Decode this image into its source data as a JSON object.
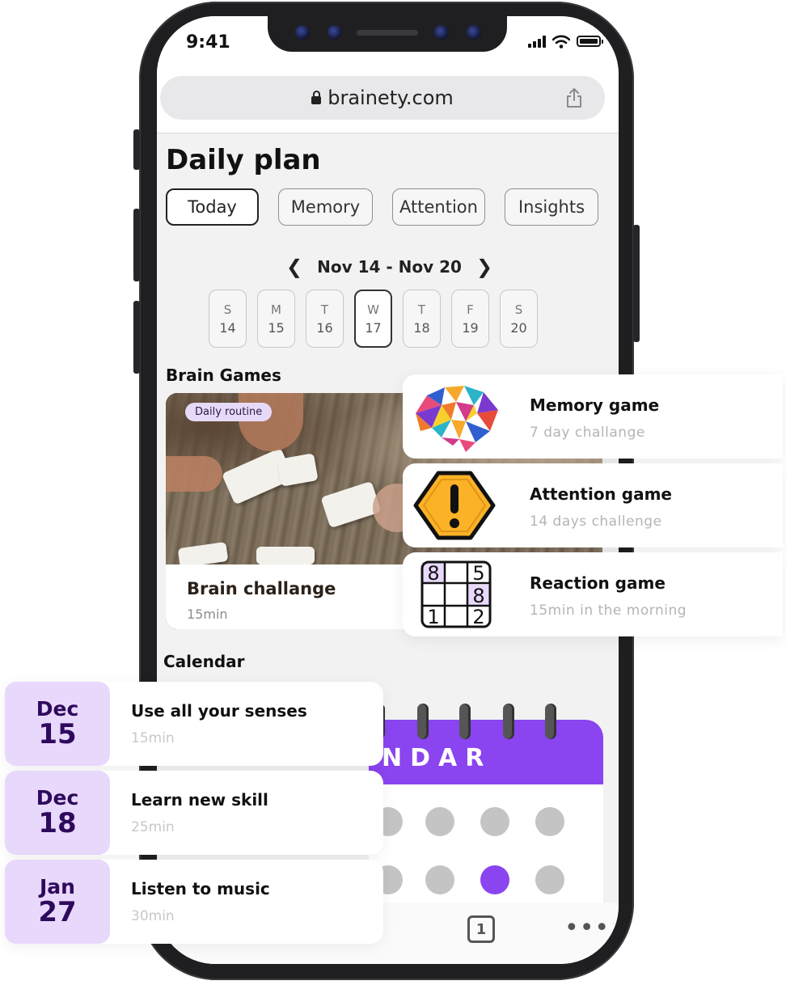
{
  "status_bar": {
    "time": "9:41"
  },
  "browser": {
    "url": "brainety.com",
    "open_tabs_count": "1"
  },
  "page": {
    "title": "Daily plan",
    "tabs": [
      {
        "label": "Today",
        "active": true
      },
      {
        "label": "Memory",
        "active": false
      },
      {
        "label": "Attention",
        "active": false
      },
      {
        "label": "Insights",
        "active": false
      }
    ],
    "week_range": "Nov 14 - Nov 20",
    "days": [
      {
        "letter": "S",
        "num": "14"
      },
      {
        "letter": "M",
        "num": "15"
      },
      {
        "letter": "T",
        "num": "16"
      },
      {
        "letter": "W",
        "num": "17",
        "selected": true
      },
      {
        "letter": "T",
        "num": "18"
      },
      {
        "letter": "F",
        "num": "19"
      },
      {
        "letter": "S",
        "num": "20"
      }
    ],
    "brain_games_label": "Brain Games",
    "featured": {
      "badge": "Daily routine",
      "title": "Brain challange",
      "duration": "15min"
    },
    "calendar_label": "Calendar",
    "calendar_header_text": "NDAR"
  },
  "games": [
    {
      "title": "Memory game",
      "subtitle": "7 day challange",
      "icon": "brain-icon"
    },
    {
      "title": "Attention game",
      "subtitle": "14 days challenge",
      "icon": "warning-icon"
    },
    {
      "title": "Reaction game",
      "subtitle": "15min in the morning",
      "icon": "sudoku-icon"
    }
  ],
  "sudoku_digits": [
    "8",
    "5",
    "8",
    "1",
    "2"
  ],
  "plans": [
    {
      "month": "Dec",
      "day": "15",
      "title": "Use all your senses",
      "duration": "15min"
    },
    {
      "month": "Dec",
      "day": "18",
      "title": "Learn new skill",
      "duration": "25min"
    },
    {
      "month": "Jan",
      "day": "27",
      "title": "Listen to music",
      "duration": "30min"
    }
  ],
  "colors": {
    "accent_purple": "#8a44f0",
    "date_badge_bg": "#e8d8fc",
    "date_text": "#2e0a5c",
    "warning_yellow": "#fbb226"
  }
}
